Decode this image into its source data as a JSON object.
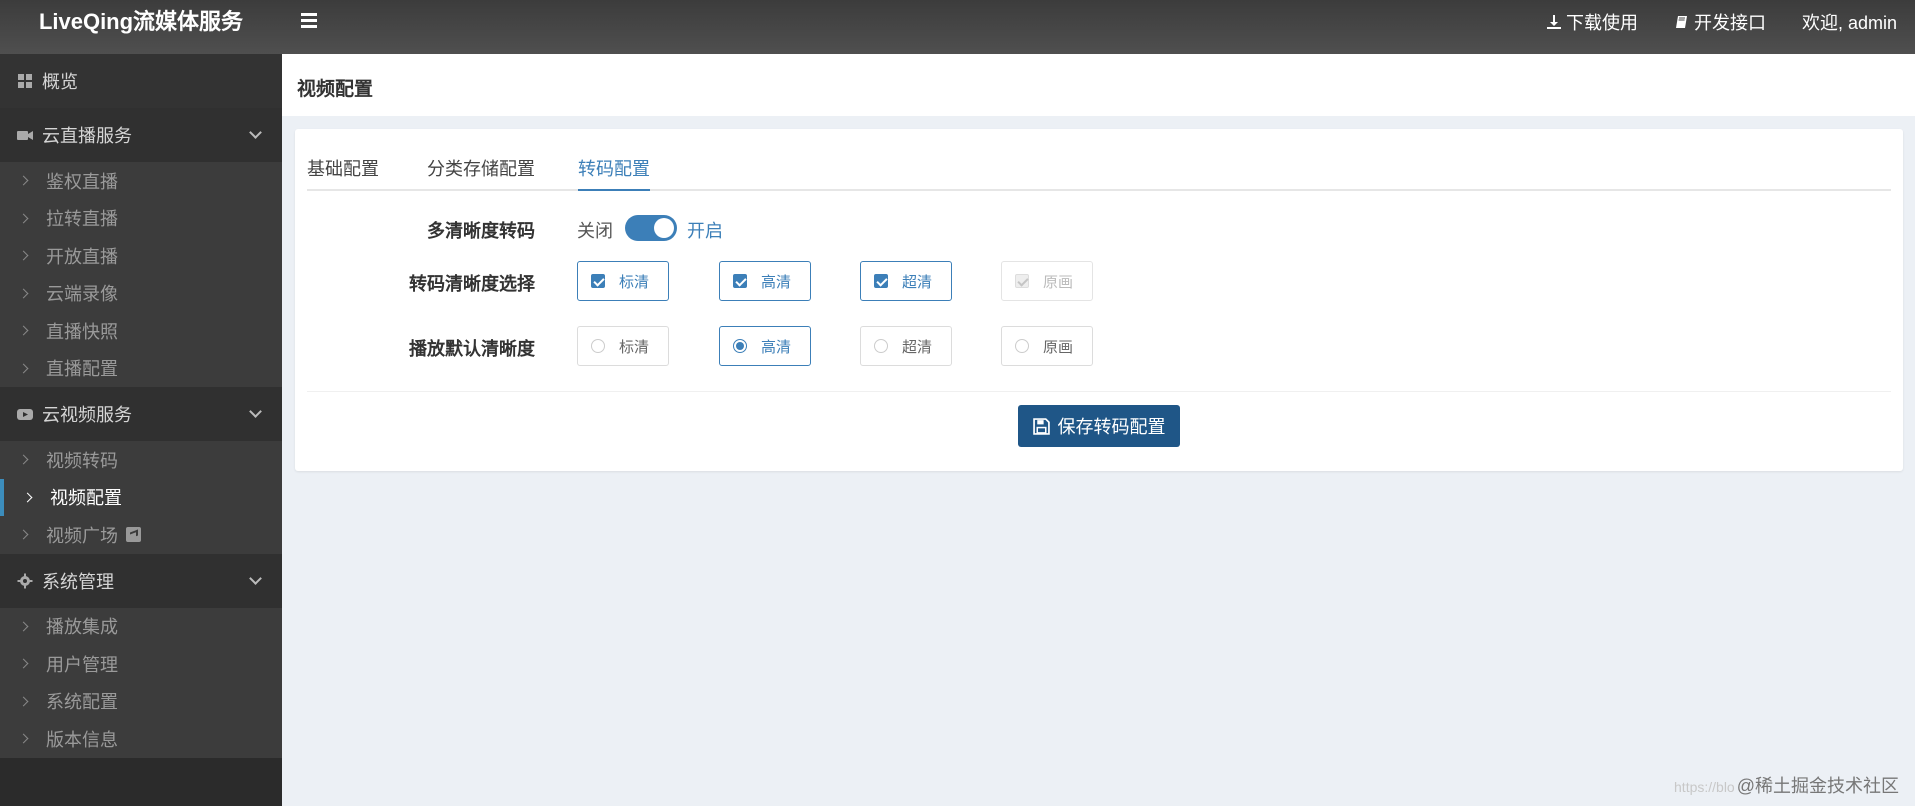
{
  "app": {
    "brand": "LiveQing流媒体服务"
  },
  "header": {
    "download": "下载使用",
    "api": "开发接口",
    "welcome": "欢迎, admin"
  },
  "sidebar": {
    "overview": "概览",
    "live_service": {
      "label": "云直播服务",
      "items": [
        "鉴权直播",
        "拉转直播",
        "开放直播",
        "云端录像",
        "直播快照",
        "直播配置"
      ]
    },
    "video_service": {
      "label": "云视频服务",
      "items": [
        "视频转码",
        "视频配置",
        "视频广场"
      ],
      "active": "视频配置"
    },
    "system": {
      "label": "系统管理",
      "items": [
        "播放集成",
        "用户管理",
        "系统配置",
        "版本信息"
      ]
    }
  },
  "page": {
    "title": "视频配置",
    "tabs": [
      "基础配置",
      "分类存储配置",
      "转码配置"
    ],
    "active_tab": "转码配置"
  },
  "form": {
    "multi_res_label": "多清晰度转码",
    "switch_off": "关闭",
    "switch_on": "开启",
    "switch_state": "on",
    "res_select_label": "转码清晰度选择",
    "res_options": [
      {
        "label": "标清",
        "checked": true,
        "disabled": false
      },
      {
        "label": "高清",
        "checked": true,
        "disabled": false
      },
      {
        "label": "超清",
        "checked": true,
        "disabled": false
      },
      {
        "label": "原画",
        "checked": true,
        "disabled": true
      }
    ],
    "default_res_label": "播放默认清晰度",
    "default_options": [
      {
        "label": "标清",
        "selected": false
      },
      {
        "label": "高清",
        "selected": true
      },
      {
        "label": "超清",
        "selected": false
      },
      {
        "label": "原画",
        "selected": false
      }
    ],
    "save_button": "保存转码配置"
  },
  "watermark": {
    "url": "https://blo",
    "text": "@稀土掘金技术社区"
  },
  "colors": {
    "accent": "#3c7fb8",
    "button": "#1f5687",
    "header": "#444444",
    "sidebar": "#2b2b2b"
  }
}
